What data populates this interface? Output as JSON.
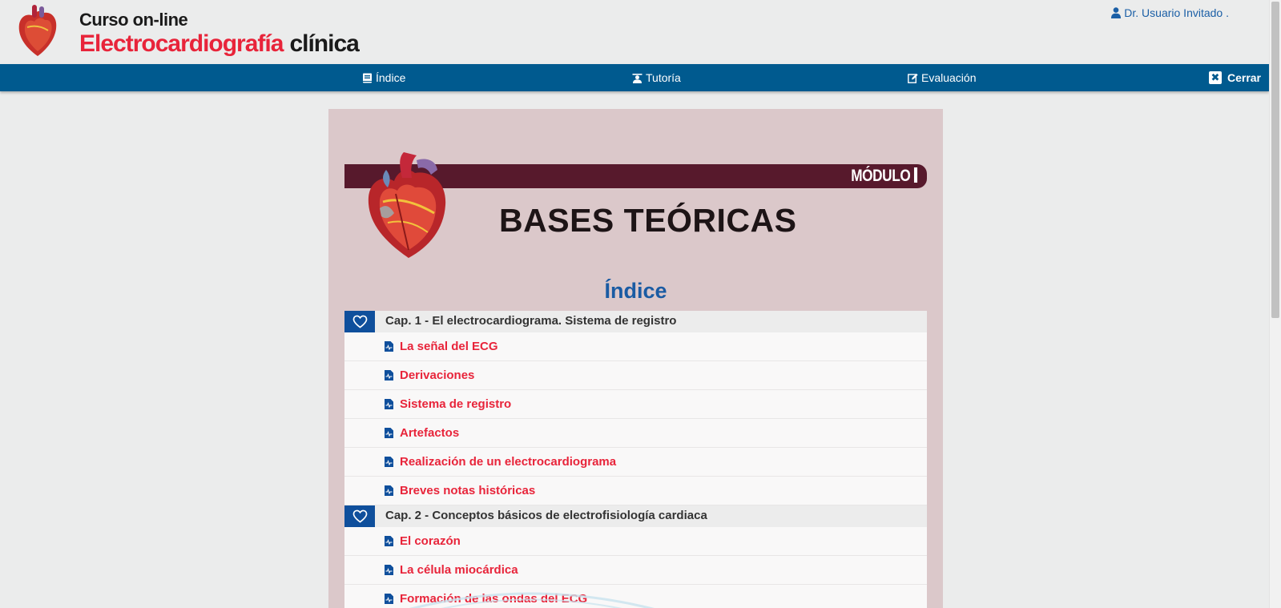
{
  "header": {
    "logo_line1": "Curso on-line",
    "logo_line2_red": "Electrocardiografía",
    "logo_line2_dark": "clínica",
    "user_label": "Dr. Usuario Invitado ."
  },
  "nav": {
    "indice": "Índice",
    "tutoria": "Tutoría",
    "evaluacion": "Evaluación",
    "cerrar": "Cerrar",
    "cerrar_glyph": "✖"
  },
  "module": {
    "label": "MÓDULO",
    "title": "BASES TEÓRICAS"
  },
  "index": {
    "title": "Índice",
    "chapters": [
      {
        "title": "Cap. 1 - El electrocardiograma. Sistema de registro",
        "lessons": [
          "La señal del ECG",
          "Derivaciones",
          "Sistema de registro",
          "Artefactos",
          "Realización de un electrocardiograma",
          "Breves notas históricas"
        ]
      },
      {
        "title": "Cap. 2 - Conceptos básicos de electrofisiología cardiaca",
        "lessons": [
          "El corazón",
          "La célula miocárdica",
          "Formación de las ondas del ECG"
        ]
      }
    ]
  },
  "icons": {
    "user": "user-icon",
    "book": "book-icon",
    "tutor": "tutor-icon",
    "edit": "edit-icon",
    "close": "close-icon",
    "heart": "heart-outline-icon",
    "document": "document-ecg-icon"
  },
  "colors": {
    "nav_bar": "#005a8f",
    "accent_red": "#e8243a",
    "title_blue": "#1a5ba3",
    "banner": "#57192c",
    "panel": "#dbc8ca",
    "fav_button": "#0f4f9c"
  }
}
